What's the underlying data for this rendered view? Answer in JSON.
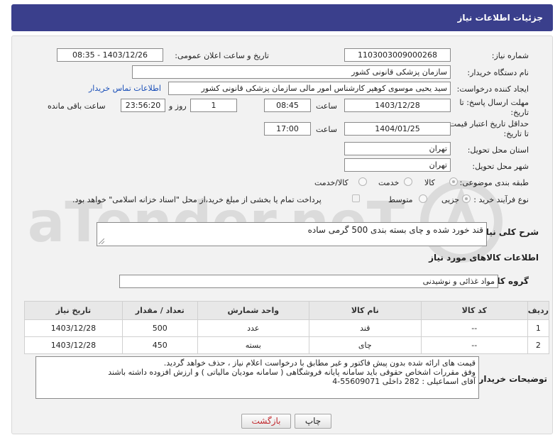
{
  "header": {
    "title": "جزئیات اطلاعات نیاز"
  },
  "form": {
    "need_number": {
      "label": "شماره نیاز:",
      "value": "1103003009000268"
    },
    "announce": {
      "label": "تاریخ و ساعت اعلان عمومی:",
      "value": "1403/12/26 - 08:35"
    },
    "buyer_org": {
      "label": "نام دستگاه خریدار:",
      "value": "سازمان پزشکی قانونی کشور"
    },
    "requester": {
      "label": "ایجاد کننده درخواست:",
      "value": "سید یحیی موسوی کوهپر کارشناس امور مالی سازمان پزشکی قانونی کشور",
      "contact_link": "اطلاعات تماس خریدار"
    },
    "reply_deadline": {
      "label": "مهلت ارسال پاسخ: تا تاریخ:",
      "date": "1403/12/28",
      "time_label": "ساعت",
      "time": "08:45",
      "days": "1",
      "days_label": "روز و",
      "remaining": "23:56:20",
      "remaining_label": "ساعت باقی مانده"
    },
    "price_validity": {
      "label": "حداقل تاریخ اعتبار قیمت: تا تاریخ:",
      "date": "1404/01/25",
      "time_label": "ساعت",
      "time": "17:00"
    },
    "province": {
      "label": "استان محل تحویل:",
      "value": "تهران"
    },
    "city": {
      "label": "شهر محل تحویل:",
      "value": "تهران"
    },
    "category": {
      "label": "طبقه بندی موضوعی:",
      "options": [
        "کالا",
        "خدمت",
        "کالا/خدمت"
      ],
      "selected": "کالا"
    },
    "process": {
      "label": "نوع فرآیند خرید :",
      "options": [
        "جزیی",
        "متوسط"
      ],
      "selected": "جزیی",
      "note": "پرداخت تمام یا بخشی از مبلغ خرید،از محل \"اسناد خزانه اسلامی\" خواهد بود."
    },
    "description": {
      "label": "شرح کلی نیاز:",
      "value": "قند خورد شده و چای بسته بندی 500 گرمی ساده"
    },
    "goods_info_title": "اطلاعات کالاهای مورد نیاز",
    "goods_group": {
      "label": "گروه کالا:",
      "value": "مواد غذائی و نوشیدنی"
    }
  },
  "table": {
    "headers": [
      "ردیف",
      "کد کالا",
      "نام کالا",
      "واحد شمارش",
      "تعداد / مقدار",
      "تاریخ نیاز"
    ],
    "rows": [
      [
        "1",
        "--",
        "قند",
        "عدد",
        "500",
        "1403/12/28"
      ],
      [
        "2",
        "--",
        "چای",
        "بسته",
        "450",
        "1403/12/28"
      ]
    ]
  },
  "buyer_notes": {
    "label": "توضیحات خریدار:",
    "lines": [
      "قیمت های ارائه شده بدون پیش فاکتور و غیر مطابق با درخواست اعلام نیاز ، حذف خواهد گردید.",
      "وفق مقررات اشخاص حقوقی باید سامانه پایانه فروشگاهی ( سامانه مودیان مالیاتی ) و ارزش افزوده داشته باشند",
      "آقای اسماعیلی : 282 داخلی 55609071-4"
    ]
  },
  "buttons": {
    "print": "چاپ",
    "back": "بازگشت"
  },
  "watermark": "AriaTender.neT",
  "colors": {
    "header_bg": "#3a3f8c",
    "link": "#1a4fb8",
    "back_text": "#c0282d"
  }
}
